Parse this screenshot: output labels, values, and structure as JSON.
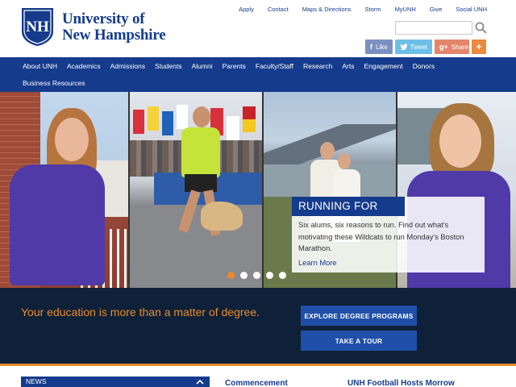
{
  "header": {
    "logo_line1": "University of",
    "logo_line2": "New Hampshire",
    "utility_links": [
      "Apply",
      "Contact",
      "Maps & Directions",
      "Storm",
      "MyUNH",
      "Give",
      "Social UNH"
    ],
    "search_placeholder": "",
    "social": {
      "like_label": "Like",
      "tweet_label": "Tweet",
      "share_label": "Share",
      "more_label": "+"
    }
  },
  "nav": {
    "row1": [
      "About UNH",
      "Academics",
      "Admissions",
      "Students",
      "Alumni",
      "Parents",
      "Faculty/Staff",
      "Research",
      "Arts",
      "Engagement",
      "Donors"
    ],
    "row2": [
      "Business Resources"
    ]
  },
  "hero": {
    "title": "RUNNING FOR GOOD",
    "body": "Six alums, six reasons to run. Find out what's motivating these Wildcats to run Monday's Boston Marathon.",
    "link": "Learn More",
    "slide_count": 5,
    "active_slide": 1
  },
  "band": {
    "tagline": "Your education is more than a matter of degree.",
    "cta_programs": "EXPLORE DEGREE PROGRAMS",
    "cta_tour": "TAKE A TOUR"
  },
  "lower": {
    "news_label": "NEWS",
    "story1": "Commencement",
    "story2": "UNH Football Hosts Morrow"
  },
  "colors": {
    "brand_blue": "#153b8c",
    "accent_orange": "#e98a2c",
    "band_dark": "#0f2138"
  }
}
